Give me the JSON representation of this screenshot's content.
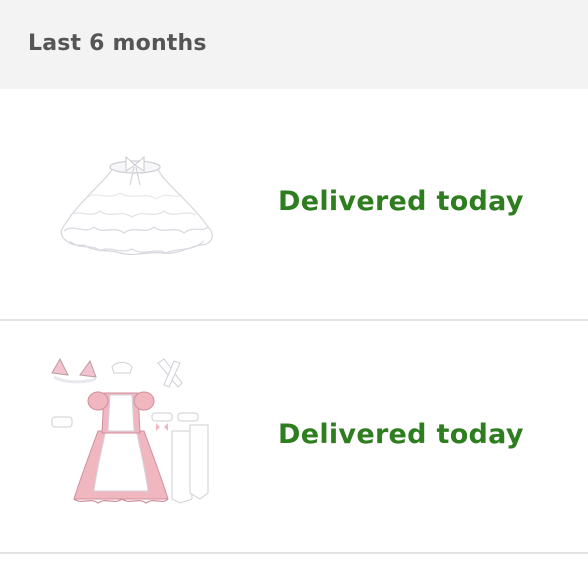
{
  "section": {
    "title": "Last 6 months"
  },
  "orders": [
    {
      "status": "Delivered today",
      "image_icon": "tutu-petticoat-thumbnail",
      "status_color": "#2e7d1f"
    },
    {
      "status": "Delivered today",
      "image_icon": "maid-costume-set-thumbnail",
      "status_color": "#2e7d1f"
    }
  ],
  "colors": {
    "header_bg": "#f3f3f3",
    "header_text": "#555555",
    "divider": "#e3e3e3",
    "status_green": "#2e7d1f"
  }
}
